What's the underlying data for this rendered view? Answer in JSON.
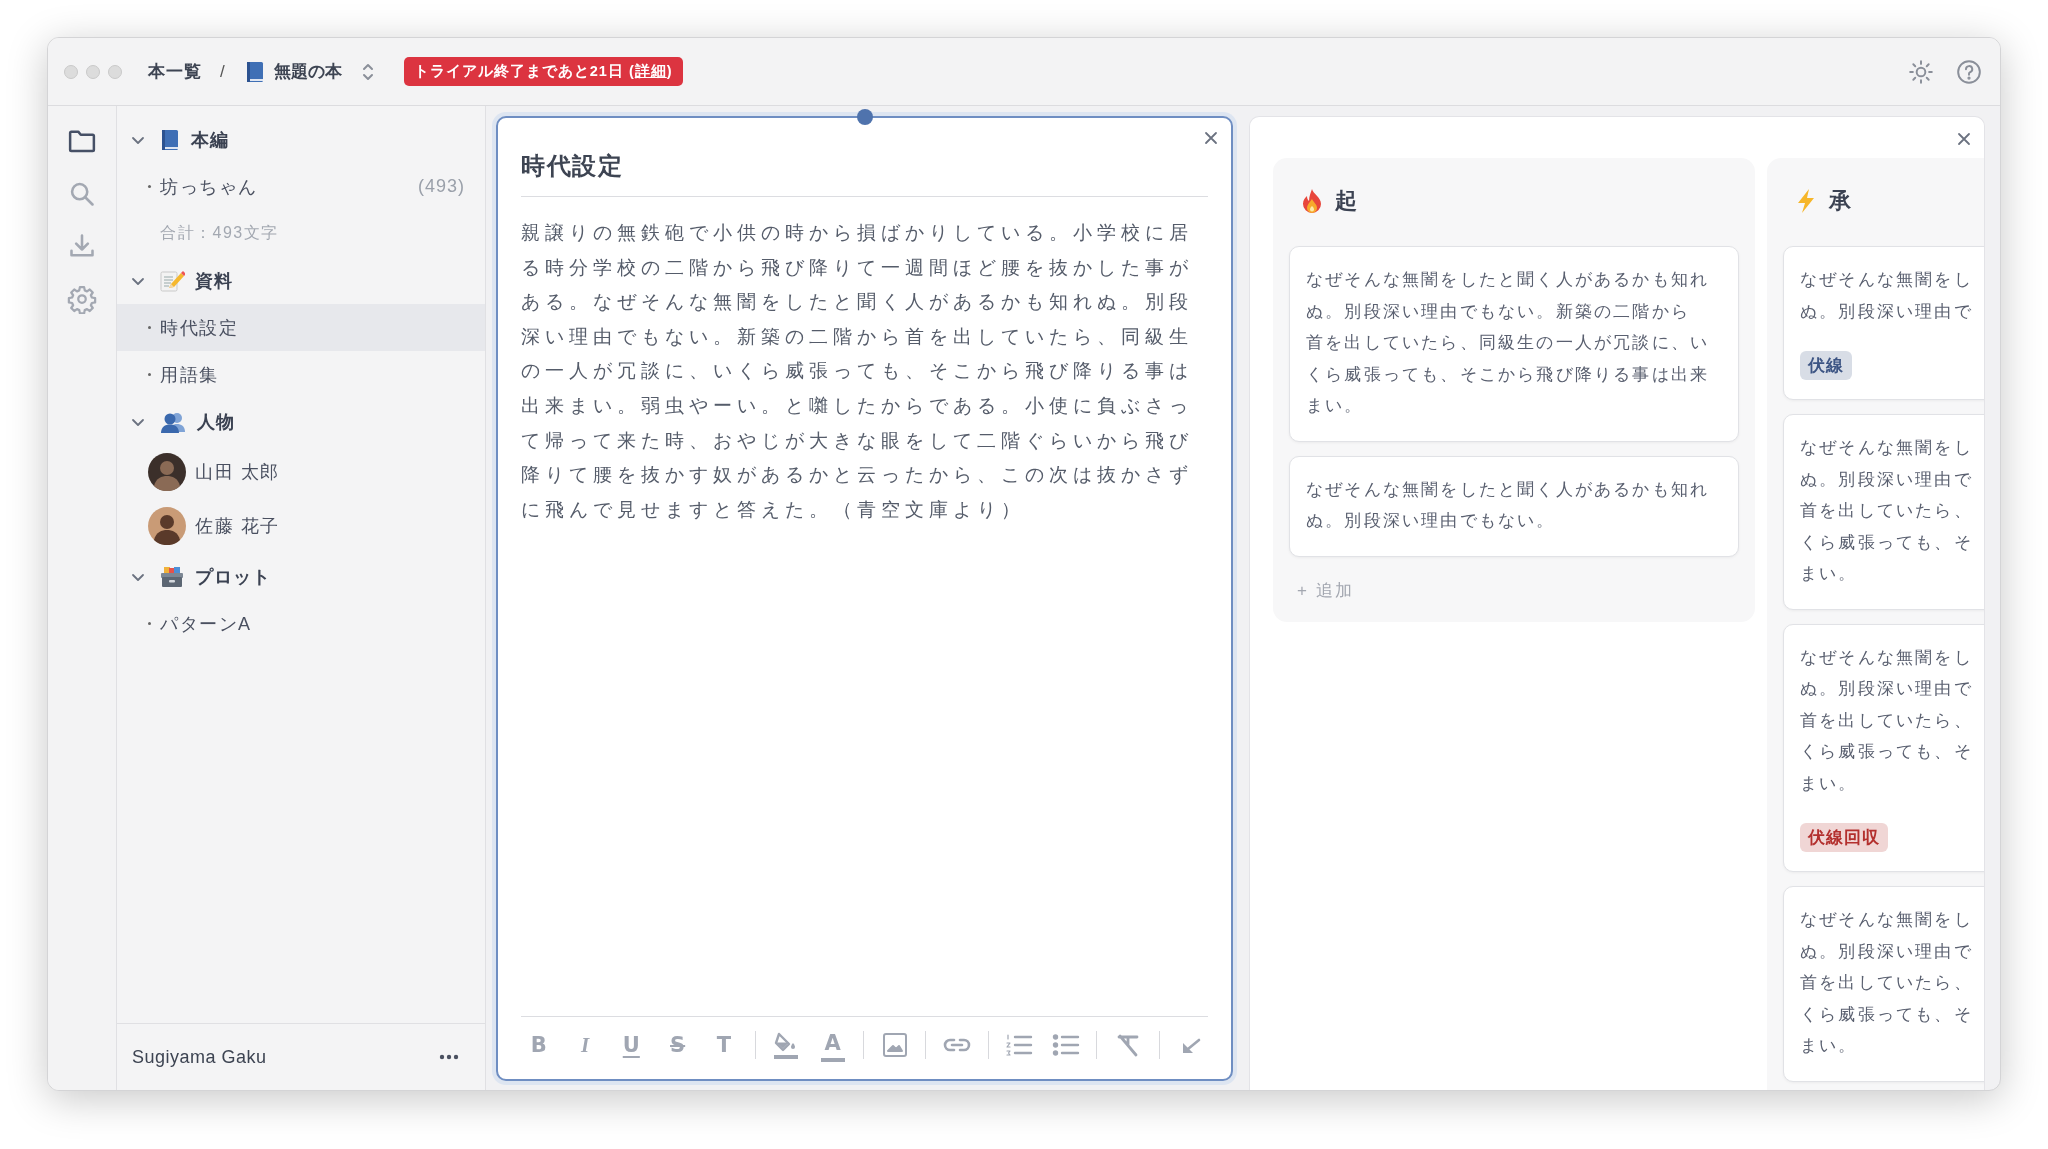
{
  "breadcrumb": {
    "root": "本一覧",
    "separator": "/",
    "book": "無題の本"
  },
  "trial_banner": {
    "before": "トライアル終了まであと21日 (",
    "link": "詳細",
    "after": ")"
  },
  "rail": [
    {
      "kind": "folder",
      "selected": true
    },
    {
      "kind": "search",
      "selected": false
    },
    {
      "kind": "download",
      "selected": false
    },
    {
      "kind": "settings",
      "selected": false
    }
  ],
  "sidebar": {
    "sections": [
      {
        "title": "本編",
        "kind": "book",
        "expanded": true,
        "children": [
          {
            "kind": "doc",
            "label": "坊っちゃん",
            "count": "(493)",
            "selected": false
          }
        ],
        "summary": "合計：493文字"
      },
      {
        "title": "資料",
        "kind": "memo",
        "expanded": true,
        "children": [
          {
            "kind": "doc",
            "label": "時代設定",
            "selected": true
          },
          {
            "kind": "doc",
            "label": "用語集",
            "selected": false
          }
        ]
      },
      {
        "title": "人物",
        "kind": "people",
        "expanded": true,
        "children": [
          {
            "kind": "person",
            "label": "山田 太郎",
            "selected": false
          },
          {
            "kind": "person",
            "label": "佐藤 花子",
            "selected": false
          }
        ]
      },
      {
        "title": "プロット",
        "kind": "box",
        "expanded": true,
        "children": [
          {
            "kind": "doc",
            "label": "パターンA",
            "selected": false
          }
        ]
      }
    ],
    "user": "Sugiyama Gaku"
  },
  "editor": {
    "title": "時代設定",
    "body": "親譲りの無鉄砲で小供の時から損ばかりしている。小学校に居る時分学校の二階から飛び降りて一週間ほど腰を抜かした事がある。なぜそんな無闇をしたと聞く人があるかも知れぬ。別段深い理由でもない。新築の二階から首を出していたら、同級生の一人が冗談に、いくら威張っても、そこから飛び降りる事は出来まい。弱虫やーい。と囃したからである。小使に負ぶさって帰って来た時、おやじが大きな眼をして二階ぐらいから飛び降りて腰を抜かす奴があるかと云ったから、この次は抜かさずに飛んで見せますと答えた。（青空文庫より）",
    "toolbar": [
      [
        {
          "kind": "bold",
          "glyph": "B"
        },
        {
          "kind": "italic",
          "glyph": "I"
        },
        {
          "kind": "underline",
          "glyph": "U"
        },
        {
          "kind": "strike",
          "glyph": "S"
        },
        {
          "kind": "text",
          "glyph": "T"
        }
      ],
      [
        {
          "kind": "highlight"
        },
        {
          "kind": "color",
          "glyph": "A"
        }
      ],
      [
        {
          "kind": "image"
        }
      ],
      [
        {
          "kind": "link"
        }
      ],
      [
        {
          "kind": "ordered"
        },
        {
          "kind": "bullets"
        }
      ],
      [
        {
          "kind": "clear"
        }
      ],
      [
        {
          "kind": "collapse"
        }
      ]
    ]
  },
  "board": {
    "columns": [
      {
        "title": "起",
        "kind": "fire",
        "add": "+ 追加",
        "cards": [
          {
            "lines": [
              "なぜそんな無闇をしたと聞く人があるかも知れ",
              "ぬ。別段深い理由でもない。新築の二階から",
              "首を出していたら、同級生の一人が冗談に、い",
              "くら威張っても、そこから飛び降りる事は出来",
              "まい。"
            ]
          },
          {
            "lines": [
              "なぜそんな無闇をしたと聞く人があるかも知れ",
              "ぬ。別段深い理由でもない。"
            ]
          }
        ]
      },
      {
        "title": "承",
        "kind": "bolt",
        "cards": [
          {
            "lines": [
              "なぜそんな無闇をし",
              "ぬ。別段深い理由で"
            ],
            "tag": {
              "label": "伏線",
              "color": "#3d5584"
            }
          },
          {
            "lines": [
              "なぜそんな無闇をし",
              "ぬ。別段深い理由で",
              "首を出していたら、",
              "くら威張っても、そ",
              "まい。"
            ]
          },
          {
            "lines": [
              "なぜそんな無闇をし",
              "ぬ。別段深い理由で",
              "首を出していたら、",
              "くら威張っても、そ",
              "まい。"
            ],
            "tag": {
              "label": "伏線回収",
              "color": "#b3302e"
            }
          },
          {
            "lines": [
              "なぜそんな無闇をし",
              "ぬ。別段深い理由で",
              "首を出していたら、",
              "くら威張っても、そ",
              "まい。"
            ]
          }
        ]
      }
    ]
  }
}
